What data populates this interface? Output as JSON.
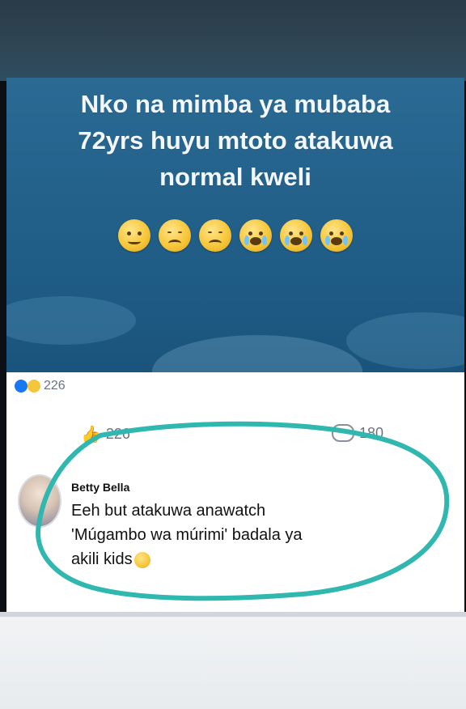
{
  "post": {
    "text_line1": "Nko na mimba ya mubaba",
    "text_line2": "72yrs huyu mtoto atakuwa",
    "text_line3": "normal kweli",
    "emoji_sequence": [
      "worried-face-icon",
      "pensive-face-icon",
      "pensive-face-icon",
      "crying-face-icon",
      "crying-face-icon",
      "crying-face-icon"
    ]
  },
  "reactions": {
    "count": "226"
  },
  "engagement": {
    "likes": "226",
    "comments": "180"
  },
  "comment": {
    "author": "Betty Bella",
    "line1": "Eeh but atakuwa anawatch",
    "line2": "'Múgambo wa múrimi' badala ya",
    "line3": "akili kids"
  },
  "colors": {
    "post_background": "#1f5c86",
    "highlight_stroke": "#2fb7b0",
    "like_blue": "#1877f2"
  }
}
